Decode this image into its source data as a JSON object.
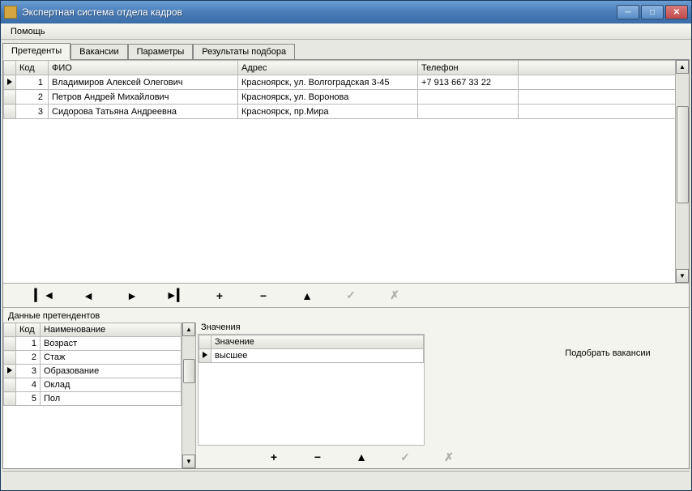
{
  "window": {
    "title": "Экспертная система отдела кадров"
  },
  "menu": {
    "help": "Помощь"
  },
  "tabs": {
    "applicants": "Претеденты",
    "vacancies": "Вакансии",
    "params": "Параметры",
    "results": "Результаты подбора"
  },
  "main_grid": {
    "headers": {
      "code": "Код",
      "fio": "ФИО",
      "address": "Адрес",
      "phone": "Телефон"
    },
    "rows": [
      {
        "code": "1",
        "fio": "Владимиров Алексей Олегович",
        "address": "Красноярск, ул. Волгоградская 3-45",
        "phone": "+7 913 667 33 22"
      },
      {
        "code": "2",
        "fio": "Петров Андрей Михайлович",
        "address": "Красноярск, ул. Воронова",
        "phone": ""
      },
      {
        "code": "3",
        "fio": "Сидорова Татьяна Андреевна",
        "address": "Красноярск, пр.Мира",
        "phone": ""
      }
    ]
  },
  "details": {
    "label": "Данные претендентов",
    "headers": {
      "code": "Код",
      "name": "Наименование"
    },
    "rows": [
      {
        "code": "1",
        "name": "Возраст"
      },
      {
        "code": "2",
        "name": "Стаж"
      },
      {
        "code": "3",
        "name": "Образование"
      },
      {
        "code": "4",
        "name": "Оклад"
      },
      {
        "code": "5",
        "name": "Пол"
      }
    ]
  },
  "values": {
    "label": "Значения",
    "headers": {
      "value": "Значение"
    },
    "rows": [
      {
        "value": "высшее"
      }
    ]
  },
  "actions": {
    "pick_vacancies": "Подобрать вакансии"
  },
  "nav_symbols": {
    "first": "▎◄",
    "prev": "◄",
    "next": "►",
    "last": "►▎",
    "insert": "+",
    "delete": "−",
    "edit": "▲",
    "post": "✓",
    "cancel": "✗"
  }
}
